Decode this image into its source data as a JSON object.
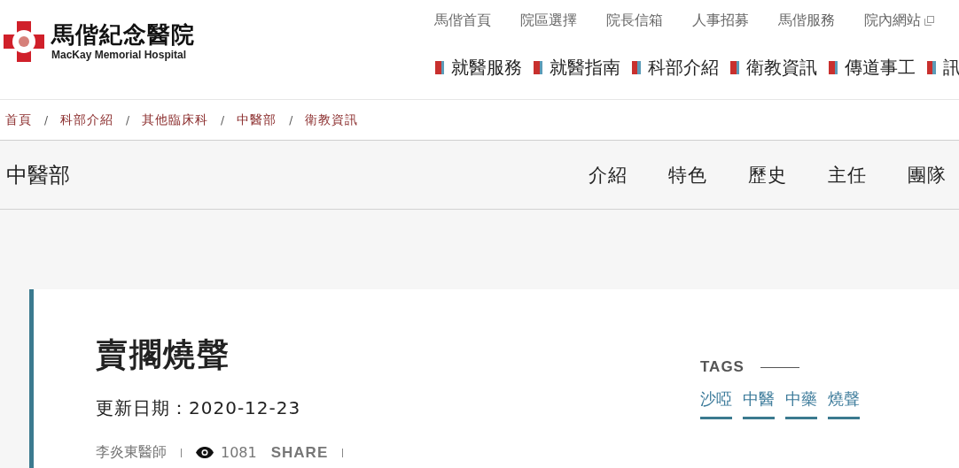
{
  "logo": {
    "name": "馬偕紀念醫院",
    "subtitle": "MacKay Memorial Hospital"
  },
  "top_links": [
    {
      "label": "馬偕首頁",
      "external": false
    },
    {
      "label": "院區選擇",
      "external": false
    },
    {
      "label": "院長信箱",
      "external": false
    },
    {
      "label": "人事招募",
      "external": false
    },
    {
      "label": "馬偕服務",
      "external": false
    },
    {
      "label": "院內網站",
      "external": true
    }
  ],
  "main_nav": [
    "就醫服務",
    "就醫指南",
    "科部介紹",
    "衛教資訊",
    "傳道事工",
    "訊"
  ],
  "breadcrumb": {
    "separator": "/",
    "items": [
      "首頁",
      "科部介紹",
      "其他臨床科",
      "中醫部",
      "衛教資訊"
    ]
  },
  "department": {
    "title": "中醫部",
    "tabs": [
      "介紹",
      "特色",
      "歷史",
      "主任",
      "團隊"
    ]
  },
  "article": {
    "title": "賣擱燒聲",
    "date_label": "更新日期：",
    "date": "2020-12-23",
    "author": "李炎東醫師",
    "views": "1081",
    "share": "SHARE"
  },
  "tags": {
    "heading": "TAGS",
    "items": [
      "沙啞",
      "中醫",
      "中藥",
      "燒聲"
    ]
  }
}
